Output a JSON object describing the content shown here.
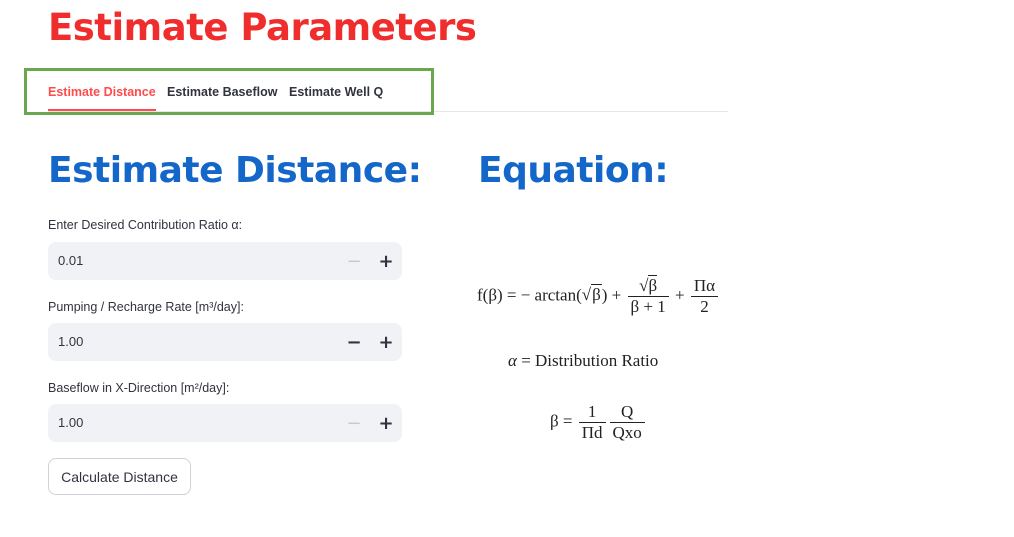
{
  "page": {
    "title": "Estimate Parameters"
  },
  "tabs": [
    {
      "label": "Estimate Distance",
      "active": true
    },
    {
      "label": "Estimate Baseflow",
      "active": false
    },
    {
      "label": "Estimate Well Q",
      "active": false
    }
  ],
  "left": {
    "heading": "Estimate Distance:",
    "fields": [
      {
        "label": "Enter Desired Contribution Ratio α:",
        "value": "0.01",
        "minus_enabled": false
      },
      {
        "label": "Pumping / Recharge Rate [m³/day]:",
        "value": "1.00",
        "minus_enabled": true
      },
      {
        "label": "Baseflow in X-Direction [m²/day]:",
        "value": "1.00",
        "minus_enabled": false
      }
    ],
    "calculate_label": "Calculate Distance"
  },
  "right": {
    "heading": "Equation:",
    "eq1": {
      "lhs": "f(β) = − arctan(",
      "sqrt_arg": "β",
      "after_sqrt": ") +",
      "frac1_num_sqrt": "β",
      "frac1_den": "β + 1",
      "plus": "+",
      "frac2_num": "Πα",
      "frac2_den": "2"
    },
    "eq2": {
      "lhs": "α",
      "rhs": "= Distribution Ratio"
    },
    "eq3": {
      "lhs": "β =",
      "frac1_num": "1",
      "frac1_den": "Πd",
      "frac2_num": "Q",
      "frac2_den": "Qxo"
    }
  },
  "icons": {
    "minus": "−",
    "plus": "+"
  },
  "colors": {
    "title": "#f02d2d",
    "heading": "#1467c9",
    "active_tab": "#ff4b4b",
    "highlight_box": "#6aa84f"
  }
}
